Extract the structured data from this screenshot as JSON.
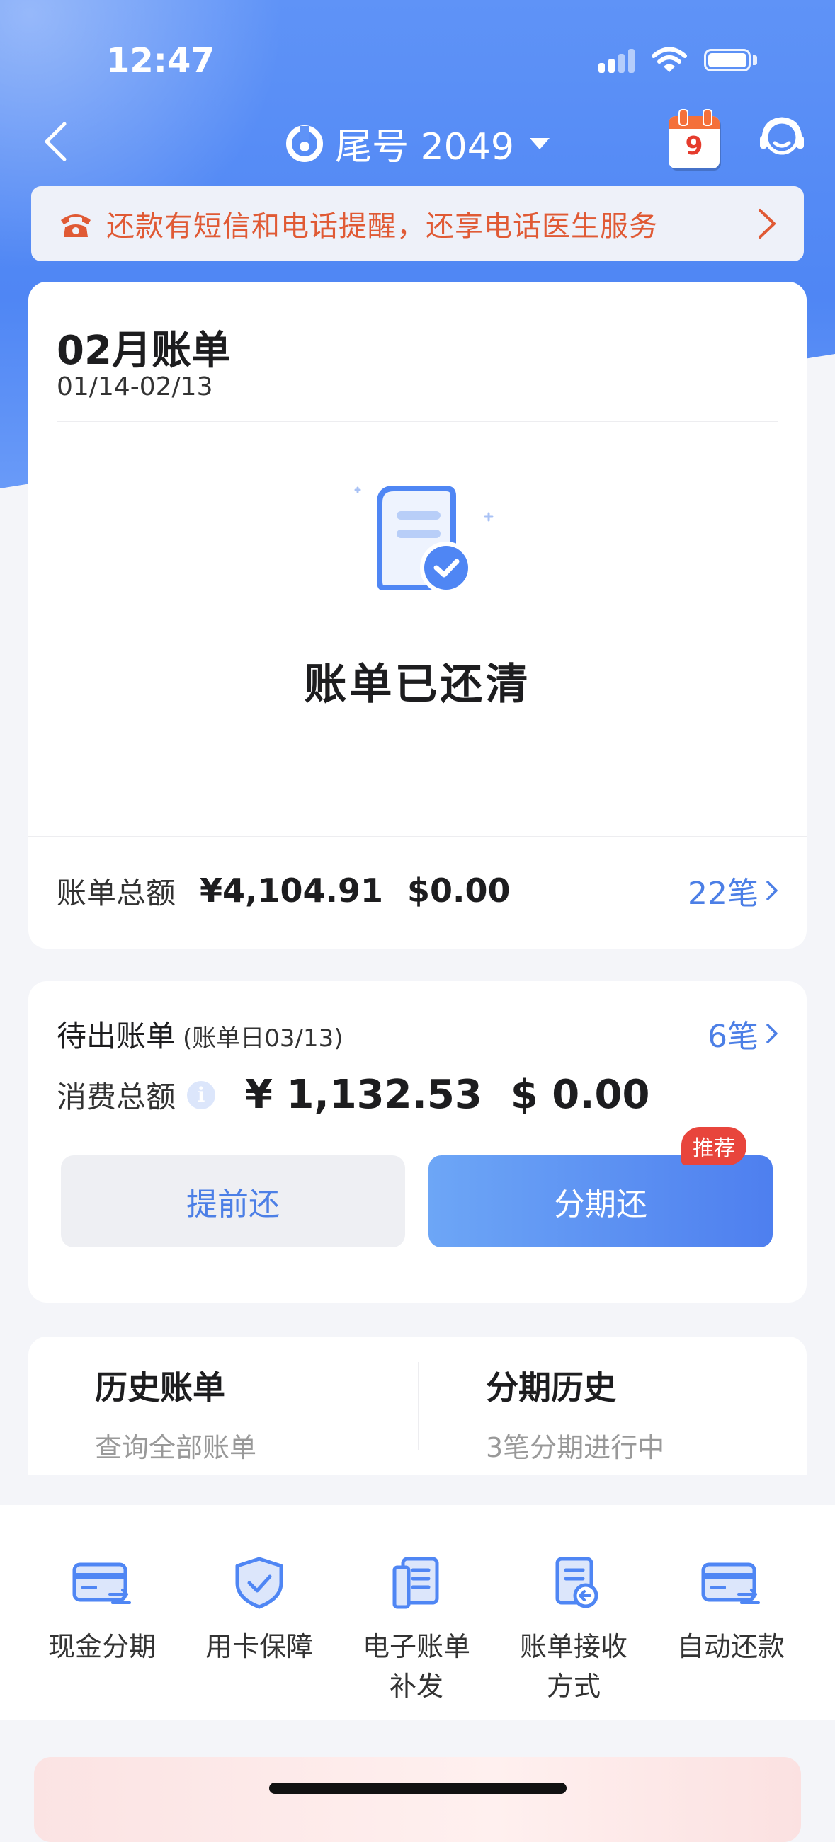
{
  "status": {
    "time": "12:47"
  },
  "nav": {
    "title": "尾号 2049",
    "calendar_day": "9"
  },
  "notice": {
    "text": "还款有短信和电话提醒，还享电话医生服务"
  },
  "bill": {
    "title": "02月账单",
    "range": "01/14-02/13",
    "status_text": "账单已还清",
    "total_label": "账单总额",
    "total_cny": "¥4,104.91",
    "total_usd": "$0.00",
    "count": "22笔"
  },
  "pending": {
    "title": "待出账单",
    "subtitle": "(账单日03/13)",
    "count": "6笔",
    "spend_label": "消费总额",
    "spend_cny": "¥ 1,132.53",
    "spend_usd": "$ 0.00",
    "prepay_label": "提前还",
    "installment_label": "分期还",
    "badge": "推荐"
  },
  "history": {
    "bills_title": "历史账单",
    "bills_sub": "查询全部账单",
    "installments_title": "分期历史",
    "installments_sub": "3笔分期进行中"
  },
  "tools": [
    {
      "label": "现金分期",
      "icon": "card-exchange-icon"
    },
    {
      "label": "用卡保障",
      "icon": "shield-check-icon"
    },
    {
      "label": "电子账单补发",
      "icon": "ebill-icon"
    },
    {
      "label": "账单接收方式",
      "icon": "bill-receive-icon"
    },
    {
      "label": "自动还款",
      "icon": "card-exchange-icon"
    }
  ],
  "colors": {
    "primary": "#4F86F4",
    "link": "#4C7FE6",
    "notice_text": "#E05A35",
    "badge": "#E8453C"
  }
}
